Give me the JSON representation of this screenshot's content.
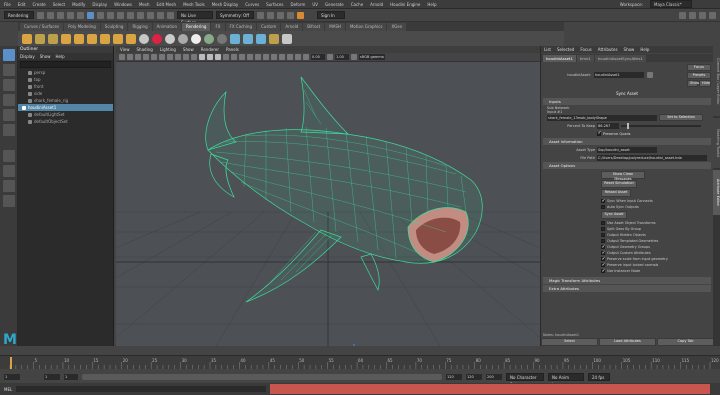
{
  "menubar": {
    "items": [
      "File",
      "Edit",
      "Create",
      "Select",
      "Modify",
      "Display",
      "Windows",
      "Mesh",
      "Edit Mesh",
      "Mesh Tools",
      "Mesh Display",
      "Curves",
      "Surfaces",
      "Deform",
      "UV",
      "Generate",
      "Cache",
      "Arnold",
      "Houdini Engine",
      "Help"
    ],
    "workspace_label": "Workspace:",
    "workspace_value": "Maya Classic*"
  },
  "statusline": {
    "mode_dropdown": "Rendering",
    "live_surface": "No Live Surface",
    "symmetry": "Symmetry: Off",
    "sign_in": "Sign In"
  },
  "shelf_tabs": [
    {
      "label": "Curves / Surfaces",
      "active": false
    },
    {
      "label": "Poly Modeling",
      "active": false
    },
    {
      "label": "Sculpting",
      "active": false
    },
    {
      "label": "Rigging",
      "active": false
    },
    {
      "label": "Animation",
      "active": false
    },
    {
      "label": "Rendering",
      "active": true
    },
    {
      "label": "FX",
      "active": false
    },
    {
      "label": "FX Caching",
      "active": false
    },
    {
      "label": "Custom",
      "active": false
    },
    {
      "label": "Arnold",
      "active": false
    },
    {
      "label": "Bifrost",
      "active": false
    },
    {
      "label": "MASH",
      "active": false
    },
    {
      "label": "Motion Graphics",
      "active": false
    },
    {
      "label": "XGen",
      "active": false
    }
  ],
  "outliner": {
    "title": "Outliner",
    "menu": [
      "Display",
      "Show",
      "Help"
    ],
    "items": [
      {
        "label": "persp",
        "selected": false
      },
      {
        "label": "top",
        "selected": false
      },
      {
        "label": "front",
        "selected": false
      },
      {
        "label": "side",
        "selected": false
      },
      {
        "label": "shark_female_rig",
        "selected": false
      },
      {
        "label": "houdiniAsset1",
        "selected": true
      },
      {
        "label": "defaultLightSet",
        "selected": false
      },
      {
        "label": "defaultObjectSet",
        "selected": false
      }
    ]
  },
  "viewport": {
    "menu": [
      "View",
      "Shading",
      "Lighting",
      "Show",
      "Renderer",
      "Panels"
    ],
    "field_a": "0.00",
    "field_b": "1.00",
    "color_space": "sRGB gamma"
  },
  "attribute_editor": {
    "menu": [
      "List",
      "Selected",
      "Focus",
      "Attributes",
      "Show",
      "Help"
    ],
    "tabs": [
      {
        "label": "houdiniAsset1",
        "active": true
      },
      {
        "label": "time1",
        "active": false
      },
      {
        "label": "houdiniAssetSyncAttrs1",
        "active": false
      }
    ],
    "node_label": "houdiniAsset:",
    "node_value": "houdiniAsset1",
    "focus_button": "Focus",
    "presets_button": "Presets",
    "show_button": "Show",
    "hide_button": "Hide",
    "panel_title": "Sync Asset",
    "sections": {
      "inputs": "Inputs",
      "asset_information": "Asset Information",
      "asset_options": "Asset Options",
      "magic_transform": "Magic Transform Attributes",
      "extra_attributes": "Extra Attributes"
    },
    "geo_input_label": "Sub Network Input #1",
    "geo_input_value": "shark_female_13mob_bodyShape",
    "set_to_selection": "Set to Selection",
    "percent_label": "Percent To Keep",
    "percent_value": "86.267",
    "preserve_quads": "Preserve Quads",
    "asset_type_label": "Asset Type",
    "asset_type_value": "Sop/houdini_asset",
    "file_path_label": "File Path",
    "file_path_value": "C:/Users/Desktop/polyreduce/houdini_asset.hda",
    "buttons": {
      "show_clean_messages": "Show Clean Messages",
      "reset_simulation": "Reset Simulation",
      "reload_asset": "Reload Asset",
      "sync_asset": "Sync Asset"
    },
    "checkboxes": [
      {
        "label": "Sync When Input Connects",
        "checked": true
      },
      {
        "label": "Auto Sync Outputs",
        "checked": false
      },
      {
        "label": "Use Asset Object Transforms",
        "checked": false
      },
      {
        "label": "Split Geos By Group",
        "checked": false
      },
      {
        "label": "Output Hidden Objects",
        "checked": false
      },
      {
        "label": "Output Templated Geometries",
        "checked": false
      },
      {
        "label": "Output Geometry Groups",
        "checked": true
      },
      {
        "label": "Output Custom Attributes",
        "checked": true
      },
      {
        "label": "Preserve scale from input geometry",
        "checked": true
      },
      {
        "label": "Preserve input locked normals",
        "checked": true
      },
      {
        "label": "Use Instancer Node",
        "checked": true
      }
    ],
    "notes": "Notes: houdiniAsset1",
    "bottom_buttons": {
      "select": "Select",
      "load_attributes": "Load Attributes",
      "copy_tab": "Copy Tab"
    }
  },
  "side_tabs": [
    "Channel Box / Layer Editor",
    "Modeling Toolkit",
    "Attribute Editor"
  ],
  "timeline": {
    "ticks": [
      "5",
      "10",
      "15",
      "20",
      "25",
      "30",
      "35",
      "40",
      "45",
      "50",
      "55",
      "60",
      "65",
      "70",
      "75",
      "80",
      "85",
      "90",
      "95",
      "100",
      "105",
      "110",
      "115",
      "120"
    ],
    "current_frame": "1"
  },
  "range": {
    "start": "1",
    "inner_start": "1",
    "inner_end": "120",
    "end": "120",
    "end2": "200",
    "character_set": "No Character Set",
    "anim_layer": "No Anim Layer",
    "fps": "24 fps"
  },
  "cmdline": {
    "lang": "MEL"
  },
  "colors": {
    "wire": "#3ddc9a",
    "selection": "#5285a6",
    "maya_blue": "#2ea7c9"
  }
}
